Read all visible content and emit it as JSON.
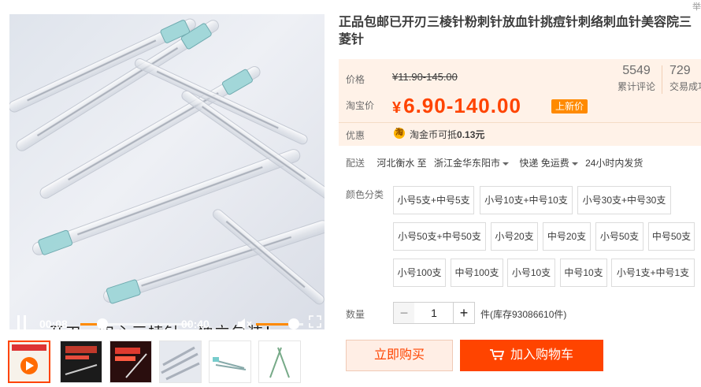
{
  "corner_text": "举",
  "video": {
    "subtitle": "开刃、实心三棱针，独立包装！",
    "current_time": "00:08",
    "total_time": "00:40",
    "progress": 0.2,
    "volume": 0.8
  },
  "thumbnails": [
    {
      "name": "thumb-video"
    },
    {
      "name": "thumb-2"
    },
    {
      "name": "thumb-3"
    },
    {
      "name": "thumb-4"
    },
    {
      "name": "thumb-5"
    },
    {
      "name": "thumb-6"
    }
  ],
  "product": {
    "title": "正品包邮已开刃三棱针粉刺针放血针挑痘针刺络刺血针美容院三菱针",
    "price_label": "价格",
    "original_price": "¥11.90-145.00",
    "taobao_label": "淘宝价",
    "currency": "¥",
    "price": "6.90-140.00",
    "new_tag": "上新价",
    "coupon_label": "优惠",
    "coupon_icon": "淘",
    "coupon_prefix": "淘金币可抵",
    "coupon_value": "0.13元",
    "stats": [
      {
        "num": "5549",
        "label": "累计评论"
      },
      {
        "num": "729",
        "label": "交易成功"
      }
    ]
  },
  "shipping": {
    "label": "配送",
    "from": "河北衡水 至",
    "to": "浙江金华东阳市",
    "method": "快递 免运费",
    "dispatch": "24小时内发货"
  },
  "sku": {
    "label": "颜色分类",
    "options": [
      "小号5支+中号5支",
      "小号10支+中号10支",
      "小号30支+中号30支",
      "小号50支+中号50支",
      "小号20支",
      "中号20支",
      "小号50支",
      "中号50支",
      "小号100支",
      "中号100支",
      "小号10支",
      "中号10支",
      "小号1支+中号1支"
    ]
  },
  "quantity": {
    "label": "数量",
    "value": "1",
    "minus": "−",
    "plus": "+",
    "stock": "件(库存93086610件)"
  },
  "actions": {
    "buy_now": "立即购买",
    "add_to_cart": "加入购物车"
  },
  "colors": {
    "accent": "#ff4400",
    "price_bg": "#fff2e8",
    "tag": "#ff8a00"
  }
}
